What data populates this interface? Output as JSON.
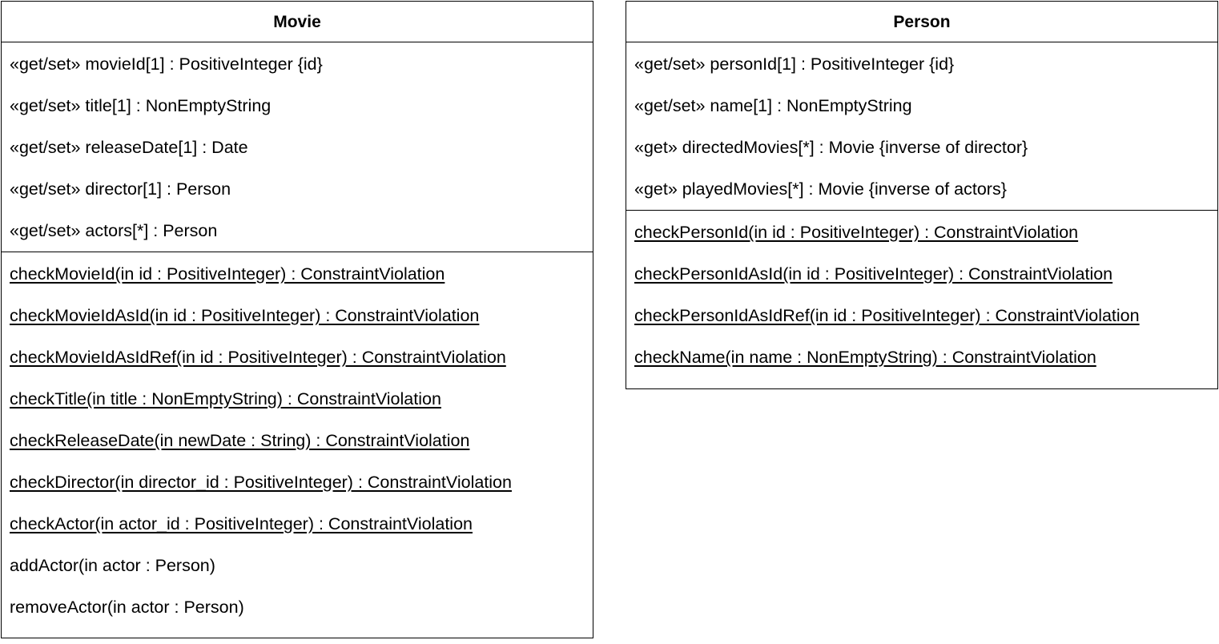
{
  "classes": [
    {
      "name": "Movie",
      "attributes": [
        "«get/set» movieId[1] : PositiveInteger {id}",
        "«get/set» title[1] : NonEmptyString",
        "«get/set» releaseDate[1] : Date",
        "«get/set» director[1] : Person",
        "«get/set» actors[*] : Person"
      ],
      "operations": [
        "checkMovieId(in id : PositiveInteger) : ConstraintViolation",
        "checkMovieIdAsId(in id : PositiveInteger) : ConstraintViolation",
        "checkMovieIdAsIdRef(in id : PositiveInteger) : ConstraintViolation",
        "checkTitle(in title : NonEmptyString) : ConstraintViolation",
        "checkReleaseDate(in newDate : String) : ConstraintViolation",
        "checkDirector(in director_id : PositiveInteger) : ConstraintViolation",
        "checkActor(in actor_id : PositiveInteger) : ConstraintViolation",
        "addActor(in actor : Person)",
        "removeActor(in actor : Person)"
      ]
    },
    {
      "name": "Person",
      "attributes": [
        "«get/set» personId[1] : PositiveInteger {id}",
        "«get/set» name[1] : NonEmptyString",
        "«get» directedMovies[*] : Movie {inverse of director}",
        "«get» playedMovies[*] : Movie {inverse of actors}"
      ],
      "operations": [
        "checkPersonId(in id : PositiveInteger) : ConstraintViolation",
        "checkPersonIdAsId(in id : PositiveInteger) : ConstraintViolation",
        "checkPersonIdAsIdRef(in id : PositiveInteger) : ConstraintViolation",
        "checkName(in name : NonEmptyString) : ConstraintViolation"
      ]
    }
  ]
}
